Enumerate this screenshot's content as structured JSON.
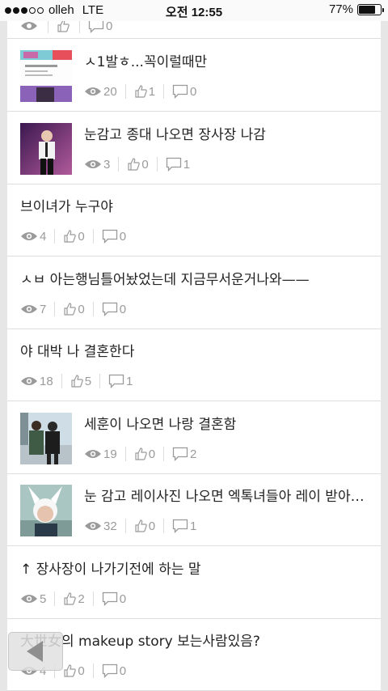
{
  "status_bar": {
    "carrier": "olleh",
    "network": "LTE",
    "time": "오전 12:55",
    "battery": "77%",
    "battery_level": 0.77,
    "signal_bars_filled": 3,
    "signal_bars_total": 5
  },
  "cut_row": {
    "views": "",
    "likes": "",
    "comments": "0"
  },
  "posts": [
    {
      "title": "ㅅ1발ㅎ...꼭이럴때만",
      "views": "20",
      "likes": "1",
      "comments": "0",
      "has_thumb": true,
      "thumb_icon": "screenshot-thumbnail"
    },
    {
      "title": "눈감고 종대 나오면 장사장 나감",
      "views": "3",
      "likes": "0",
      "comments": "1",
      "has_thumb": true,
      "thumb_icon": "singer-photo-thumbnail"
    },
    {
      "title": "브이녀가 누구야",
      "views": "4",
      "likes": "0",
      "comments": "0",
      "has_thumb": false
    },
    {
      "title": "ㅅㅂ 아는행님틀어놨었는데 지금무서운거나와——",
      "views": "7",
      "likes": "0",
      "comments": "0",
      "has_thumb": false
    },
    {
      "title": "야 대박 나 결혼한다",
      "views": "18",
      "likes": "5",
      "comments": "1",
      "has_thumb": false
    },
    {
      "title": "세훈이 나오면 나랑 결혼함",
      "views": "19",
      "likes": "0",
      "comments": "2",
      "has_thumb": true,
      "thumb_icon": "street-photo-thumbnail"
    },
    {
      "title": "눈 감고 레이사진 나오면 엑톡녀들아 레이 받아조…",
      "views": "32",
      "likes": "0",
      "comments": "1",
      "has_thumb": true,
      "thumb_icon": "bunny-ears-photo-thumbnail"
    },
    {
      "title": "↑ 장사장이 나가기전에 하는 말",
      "views": "5",
      "likes": "2",
      "comments": "0",
      "has_thumb": false
    },
    {
      "title": "大世女의 makeup story 보는사람있음?",
      "views": "4",
      "likes": "0",
      "comments": "0",
      "has_thumb": false
    }
  ],
  "icons": {
    "views": "eye-icon",
    "likes": "thumbs-up-icon",
    "comments": "speech-bubble-icon",
    "back": "back-arrow-icon"
  },
  "colors": {
    "meta_text": "#9a9a9a",
    "title_text": "#222222",
    "divider": "#dedede"
  }
}
